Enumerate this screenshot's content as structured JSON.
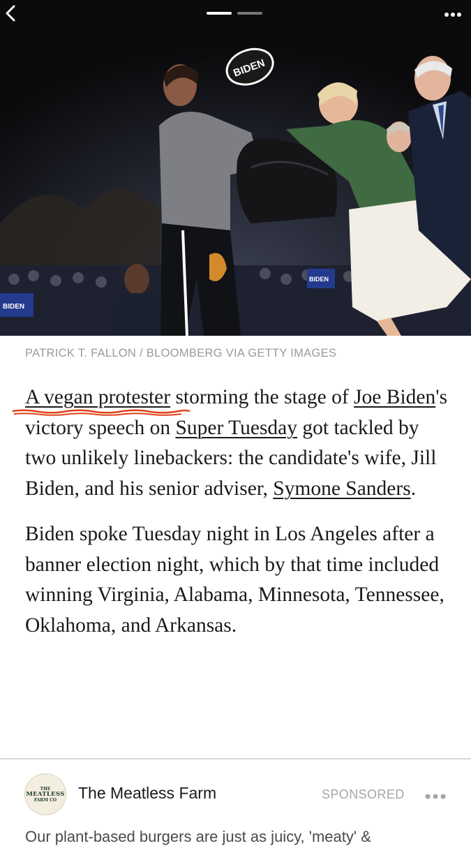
{
  "nav": {
    "back_icon": "chevron-left-icon",
    "more_icon": "ellipsis-horizontal-icon",
    "pager": {
      "active_index": 0,
      "count": 2
    }
  },
  "photo": {
    "sign_text": "BIDEN",
    "crowd_sign_1": "BIDEN",
    "crowd_sign_2": "BIDEN"
  },
  "caption": "PATRICK T. FALLON / BLOOMBERG VIA GETTY IMAGES",
  "article": {
    "p1": {
      "link_vegan": "A vegan protester",
      "t1": " storming the stage of ",
      "link_joe": "Joe Biden",
      "t2": "'s victory speech on ",
      "link_super": "Super Tuesday",
      "t3": " got tackled by two unlikely linebackers: the candidate's wife, Jill Biden, and his senior adviser, ",
      "link_symone": "Symone Sanders",
      "t4": "."
    },
    "p2": "Biden spoke Tuesday night in Los Angeles after a banner election night, which by that time included winning Virginia, Alabama, Minnesota, Tennessee, Oklahoma, and Arkansas."
  },
  "ad": {
    "logo_small_1": "THE",
    "logo_big": "MEATLESS",
    "logo_small_2": "FARM CO",
    "name": "The Meatless Farm",
    "sponsored": "SPONSORED",
    "text": "Our plant-based burgers are just as juicy, 'meaty' &"
  },
  "colors": {
    "annotation_underline": "#e0421c",
    "caption_gray": "#9a9a9a"
  }
}
